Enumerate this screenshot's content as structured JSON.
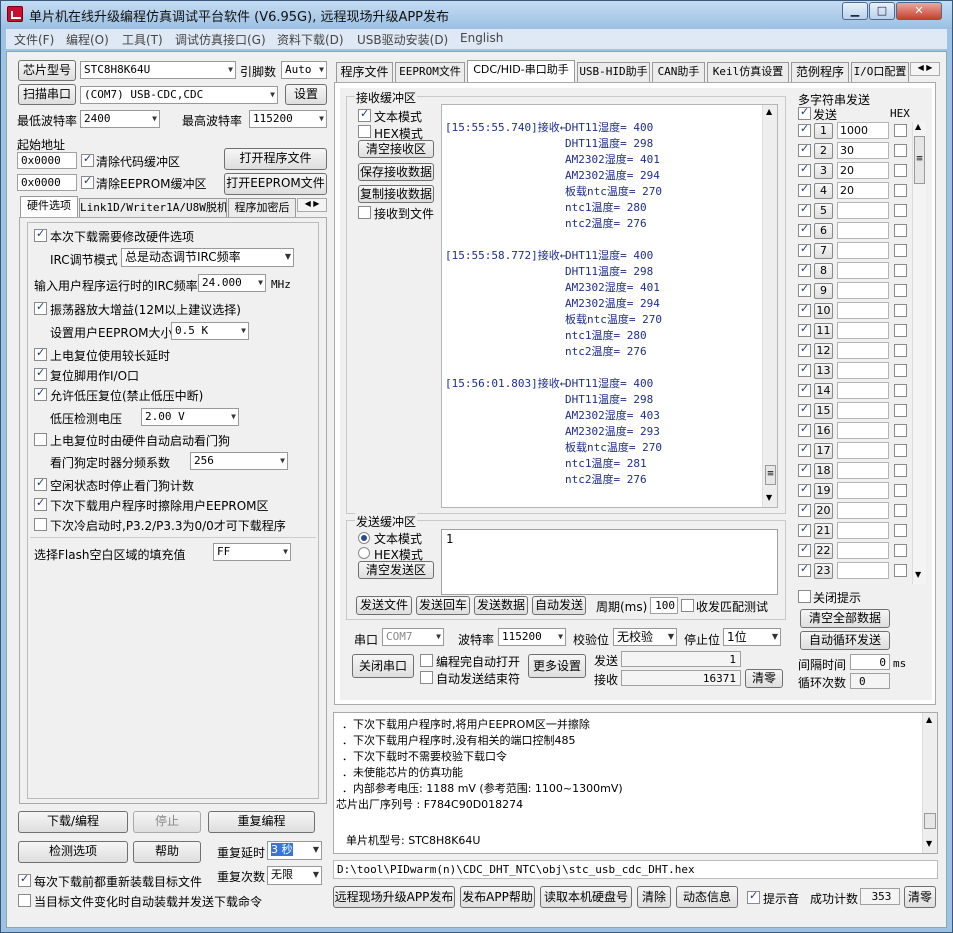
{
  "window": {
    "title": "单片机在线升级编程仿真调试平台软件 (V6.95G), 远程现场升级APP发布",
    "minimize": "▁",
    "maximize": "□",
    "close": "✕"
  },
  "menu": [
    "文件(F)",
    "编程(O)",
    "工具(T)",
    "调试仿真接口(G)",
    "资料下载(D)",
    "USB驱动安装(D)",
    "English"
  ],
  "left": {
    "chip_btn": "芯片型号",
    "chip_value": "STC8H8K64U",
    "pins_label": "引脚数",
    "pins_value": "Auto",
    "scan_btn": "扫描串口",
    "port_value": "(COM7) USB-CDC,CDC",
    "settings_btn": "设置",
    "min_baud_label": "最低波特率",
    "min_baud": "2400",
    "max_baud_label": "最高波特率",
    "max_baud": "115200",
    "start_addr_label": "起始地址",
    "addr1": "0x0000",
    "clear_code_label": "清除代码缓冲区",
    "open_prog_btn": "打开程序文件",
    "addr2": "0x0000",
    "clear_eeprom_label": "清除EEPROM缓冲区",
    "open_eeprom_btn": "打开EEPROM文件",
    "tabs": [
      "硬件选项",
      "Link1D/Writer1A/U8W脱机",
      "程序加密后"
    ],
    "hw": {
      "opt1": "本次下载需要修改硬件选项",
      "irc_mode_label": "IRC调节模式",
      "irc_mode": "总是动态调节IRC频率",
      "irc_freq_label": "输入用户程序运行时的IRC频率",
      "irc_freq": "24.000",
      "mhz": "MHz",
      "opt_osc": "振荡器放大增益(12M以上建议选择)",
      "eeprom_size_label": "设置用户EEPROM大小",
      "eeprom_size": "0.5 K",
      "opt_delay": "上电复位使用较长延时",
      "opt_resetio": "复位脚用作I/O口",
      "opt_lvr": "允许低压复位(禁止低压中断)",
      "lvd_label": "低压检测电压",
      "lvd": "2.00 V",
      "opt_wdt": "上电复位时由硬件自动启动看门狗",
      "wdt_div_label": "看门狗定时器分频系数",
      "wdt_div": "256",
      "opt_idle": "空闲状态时停止看门狗计数",
      "opt_erase": "下次下载用户程序时擦除用户EEPROM区",
      "opt_p32": "下次冷启动时,P3.2/P3.3为0/0才可下载程序",
      "fill_label": "选择Flash空白区域的填充值",
      "fill": "FF"
    },
    "download_btn": "下载/编程",
    "stop_btn": "停止",
    "reprog_btn": "重复编程",
    "detect_btn": "检测选项",
    "help_btn": "帮助",
    "repeat_delay_label": "重复延时",
    "repeat_delay": "3 秒",
    "repeat_count_label": "重复次数",
    "repeat_count": "无限",
    "reload_label": "每次下载前都重新装载目标文件",
    "auto_load_label": "当目标文件变化时自动装载并发送下载命令"
  },
  "right_tabs": [
    "程序文件",
    "EEPROM文件",
    "CDC/HID-串口助手",
    "USB-HID助手",
    "CAN助手",
    "Keil仿真设置",
    "范例程序",
    "I/O口配置"
  ],
  "serial": {
    "rx_group": "接收缓冲区",
    "text_mode": "文本模式",
    "hex_mode": "HEX模式",
    "clear_rx": "清空接收区",
    "save_rx": "保存接收数据",
    "copy_rx": "复制接收数据",
    "rx_to_file": "接收到文件",
    "rx_blocks": [
      {
        "time": "[15:55:55.740]接收←",
        "lines": [
          "DHT11湿度= 400",
          "DHT11温度= 298",
          "AM2302湿度= 401",
          "AM2302温度= 294",
          "板载ntc温度= 270",
          "ntc1温度= 280",
          "ntc2温度= 276"
        ]
      },
      {
        "time": "[15:55:58.772]接收←",
        "lines": [
          "DHT11湿度= 400",
          "DHT11温度= 298",
          "AM2302湿度= 401",
          "AM2302温度= 294",
          "板载ntc温度= 270",
          "ntc1温度= 280",
          "ntc2温度= 276"
        ]
      },
      {
        "time": "[15:56:01.803]接收←",
        "lines": [
          "DHT11湿度= 400",
          "DHT11温度= 298",
          "AM2302湿度= 403",
          "AM2302温度= 293",
          "板载ntc温度= 270",
          "ntc1温度= 281",
          "ntc2温度= 276"
        ]
      }
    ],
    "tx_group": "发送缓冲区",
    "tx_text_mode": "文本模式",
    "tx_hex_mode": "HEX模式",
    "clear_tx": "清空发送区",
    "tx_value": "1",
    "send_file": "发送文件",
    "send_cr": "发送回车",
    "send_data": "发送数据",
    "auto_send": "自动发送",
    "period_label": "周期(ms)",
    "period": "100",
    "match_test": "收发匹配测试",
    "port_label": "串口",
    "port": "COM7",
    "baud_label": "波特率",
    "baud": "115200",
    "parity_label": "校验位",
    "parity": "无校验",
    "stop_label": "停止位",
    "stopbits": "1位",
    "close_port": "关闭串口",
    "auto_open": "编程完自动打开",
    "auto_end": "自动发送结束符",
    "more_settings": "更多设置",
    "tx_count_label": "发送",
    "tx_count": "1",
    "rx_count_label": "接收",
    "rx_count": "16371",
    "clear_count": "清零"
  },
  "multi": {
    "title": "多字符串发送",
    "send_col": "发送",
    "hex_col": "HEX",
    "rows": [
      {
        "n": "1",
        "v": "1000"
      },
      {
        "n": "2",
        "v": "30"
      },
      {
        "n": "3",
        "v": "20"
      },
      {
        "n": "4",
        "v": "20"
      },
      {
        "n": "5",
        "v": ""
      },
      {
        "n": "6",
        "v": ""
      },
      {
        "n": "7",
        "v": ""
      },
      {
        "n": "8",
        "v": ""
      },
      {
        "n": "9",
        "v": ""
      },
      {
        "n": "10",
        "v": ""
      },
      {
        "n": "11",
        "v": ""
      },
      {
        "n": "12",
        "v": ""
      },
      {
        "n": "13",
        "v": ""
      },
      {
        "n": "14",
        "v": ""
      },
      {
        "n": "15",
        "v": ""
      },
      {
        "n": "16",
        "v": ""
      },
      {
        "n": "17",
        "v": ""
      },
      {
        "n": "18",
        "v": ""
      },
      {
        "n": "19",
        "v": ""
      },
      {
        "n": "20",
        "v": ""
      },
      {
        "n": "21",
        "v": ""
      },
      {
        "n": "22",
        "v": ""
      },
      {
        "n": "23",
        "v": ""
      }
    ],
    "close_hint": "关闭提示",
    "clear_all": "清空全部数据",
    "auto_loop": "自动循环发送",
    "interval_label": "间隔时间",
    "interval": "0",
    "ms": "ms",
    "loop_label": "循环次数",
    "loop": "0"
  },
  "log": {
    "lines": [
      "．下次下载用户程序时,将用户EEPROM区一并擦除",
      "．下次下载用户程序时,没有相关的端口控制485",
      "．下次下载时不需要校验下载口令",
      "．未使能芯片的仿真功能",
      "．内部参考电压: 1188 mV (参考范围: 1100~1300mV)",
      "芯片出厂序列号 : F784C90D018274",
      "",
      "单片机型号: STC8H8K64U"
    ]
  },
  "filepath": "D:\\tool\\PIDwarm(n)\\CDC_DHT_NTC\\obj\\stc_usb_cdc_DHT.hex",
  "bottom": {
    "publish": "远程现场升级APP发布",
    "publish_help": "发布APP帮助",
    "read_disk": "读取本机硬盘号",
    "clear": "清除",
    "dynamic": "动态信息",
    "beep": "提示音",
    "success_label": "成功计数",
    "success": "353",
    "clear2": "清零"
  }
}
